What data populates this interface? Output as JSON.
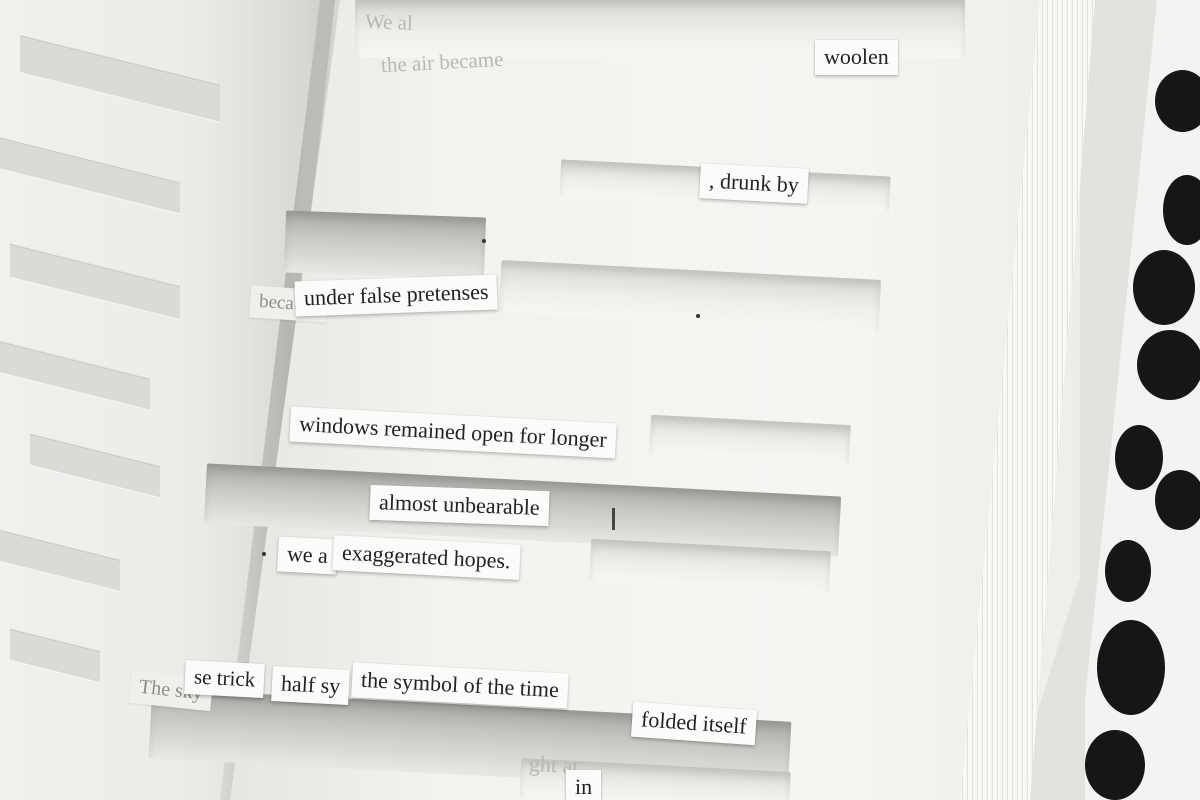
{
  "page": {
    "colors": {
      "paper": "#f6f5f2",
      "ink": "#222222",
      "cover_ink": "#161616"
    }
  },
  "faint_text": {
    "top_fragment": "We al",
    "left_fragment": "the air became",
    "lower_fragment": "ght at"
  },
  "strips": {
    "woolen": "woolen",
    "drunk_by": ", drunk by",
    "because": "because",
    "under_false_pretenses": "under false pretenses",
    "windows": "windows remained open for longer",
    "almost_unbearable": "almost unbearable",
    "we_a": "we a",
    "exaggerated": "exaggerated hopes.",
    "the_sky": "The sky",
    "se_trick": "se trick",
    "half_sy": "half sy",
    "symbol": "the symbol of the time",
    "folded": "folded itself",
    "in": "in"
  },
  "icons": {
    "cover": "ink-spot-pattern"
  }
}
